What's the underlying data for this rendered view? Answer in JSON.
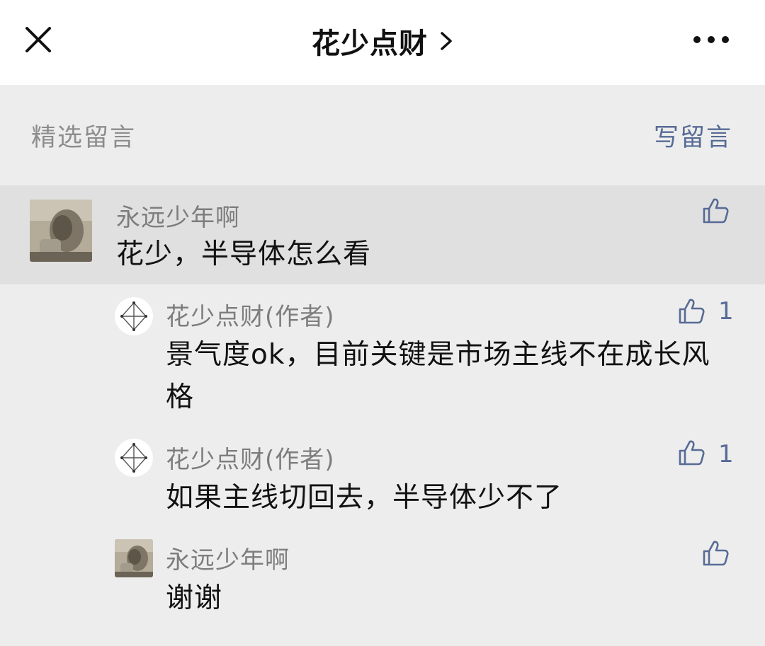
{
  "header": {
    "title": "花少点财"
  },
  "section": {
    "label": "精选留言",
    "write_label": "写留言"
  },
  "comments": [
    {
      "author": "永远少年啊",
      "text": "花少，半导体怎么看",
      "likes": "",
      "replies": [
        {
          "author": "花少点财(作者)",
          "text": "景气度ok，目前关键是市场主线不在成长风格",
          "likes": "1"
        },
        {
          "author": "花少点财(作者)",
          "text": "如果主线切回去，半导体少不了",
          "likes": "1"
        },
        {
          "author": "永远少年啊",
          "text": "谢谢",
          "likes": ""
        }
      ]
    }
  ],
  "colors": {
    "link": "#576b95",
    "highlight": "#e0e0e0",
    "background": "#ededed"
  }
}
